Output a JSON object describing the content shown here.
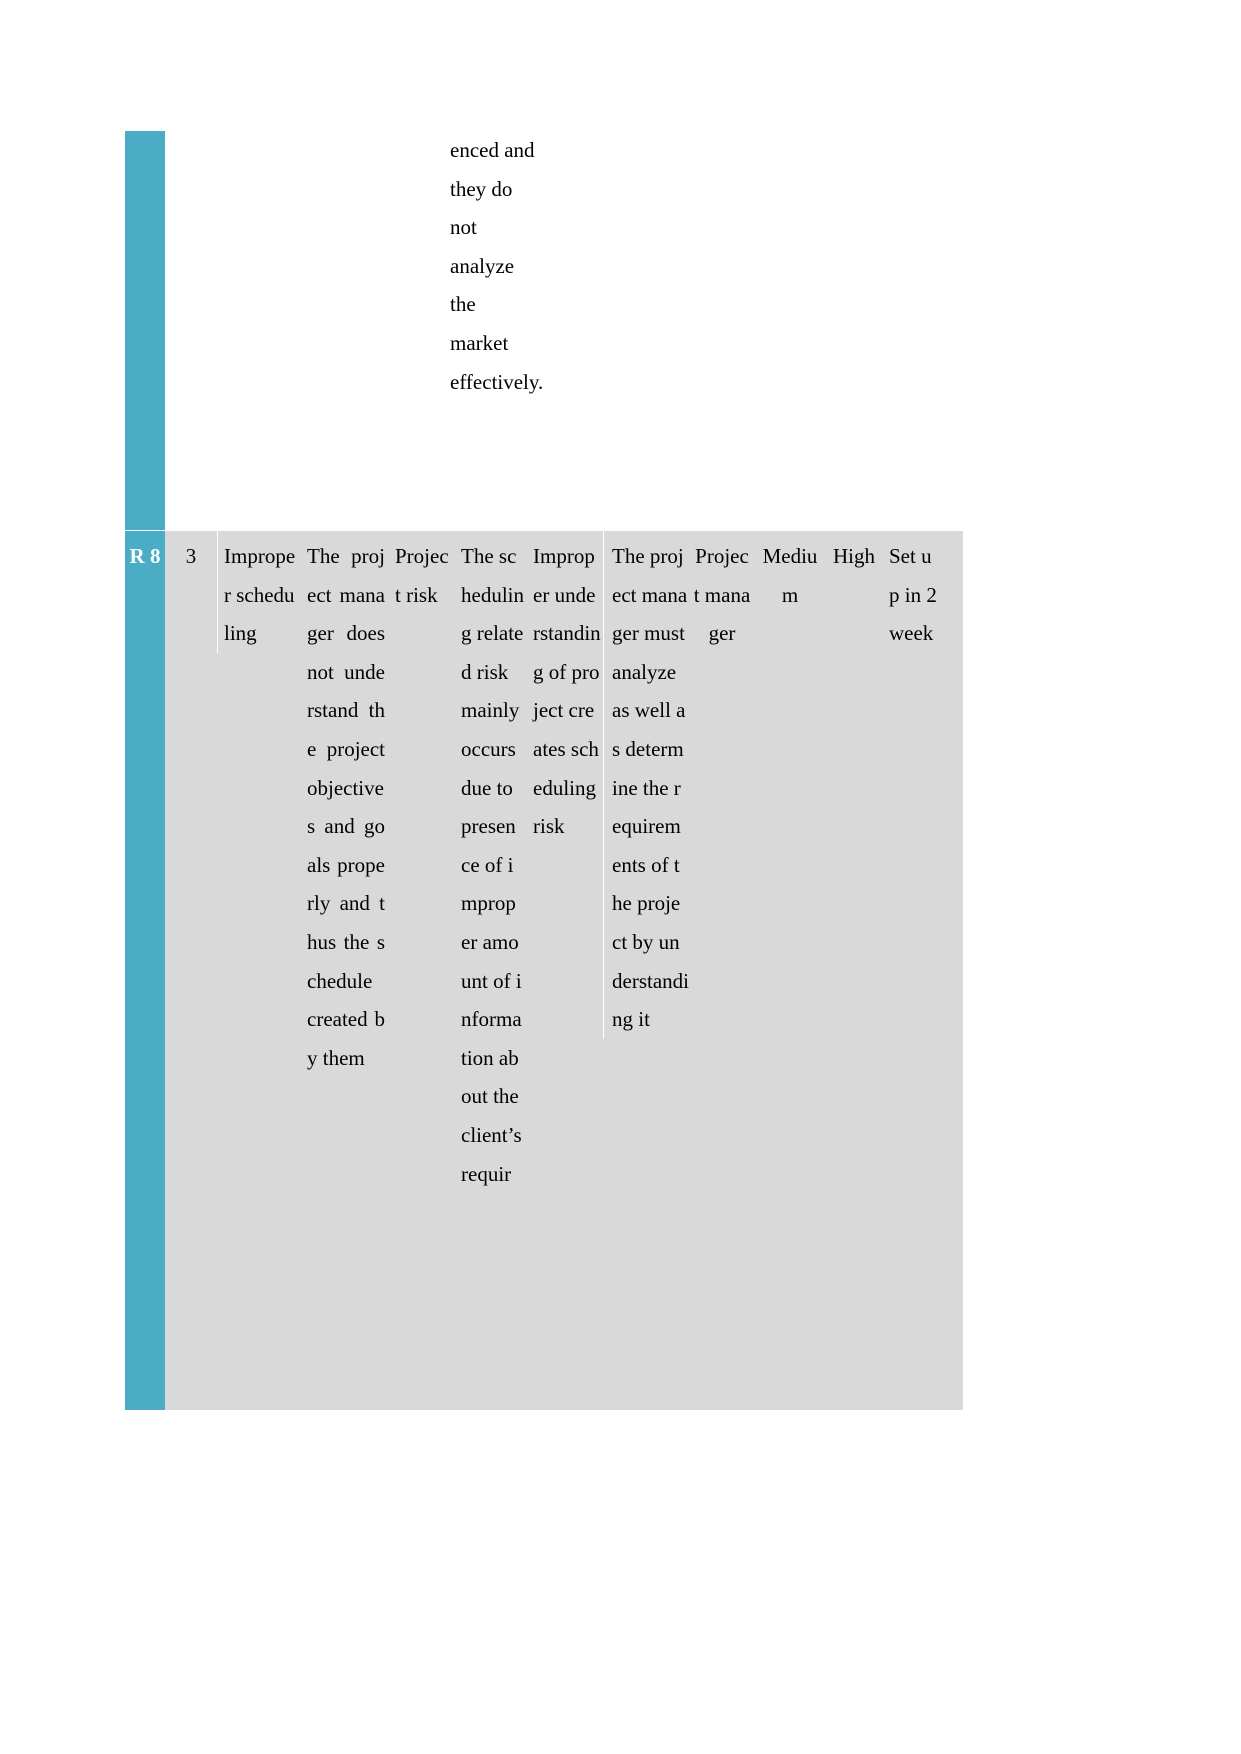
{
  "theme": {
    "accent_color": "#4BACC6",
    "row_fill_color": "#D9D9D9",
    "text_color": "#000000",
    "accent_text_color": "#FFFFFF"
  },
  "continued_row": {
    "description_fragment": "enced and they do not analyze the market effectively."
  },
  "risk_row": {
    "risk_id": "R\n8",
    "risk_id_plain": "R8",
    "no": "3",
    "risk_title": "Improper scheduling",
    "risk_description": "The project manager does not understand the project objectives and goals properly and thus the schedule created by them",
    "risk_category": "Project risk",
    "risk_cause": "The scheduling related risk mainly occurs due to presence of improper amount of information about the client’s requir",
    "risk_effect": "Improper understanding of project creates scheduling risk",
    "risk_response": "The project manager must analyze as well as determine the requirements of the project by understanding it",
    "risk_owner": "Project manager",
    "probability": "Medium",
    "impact": "High",
    "timeline": "Set up in 2 week"
  }
}
